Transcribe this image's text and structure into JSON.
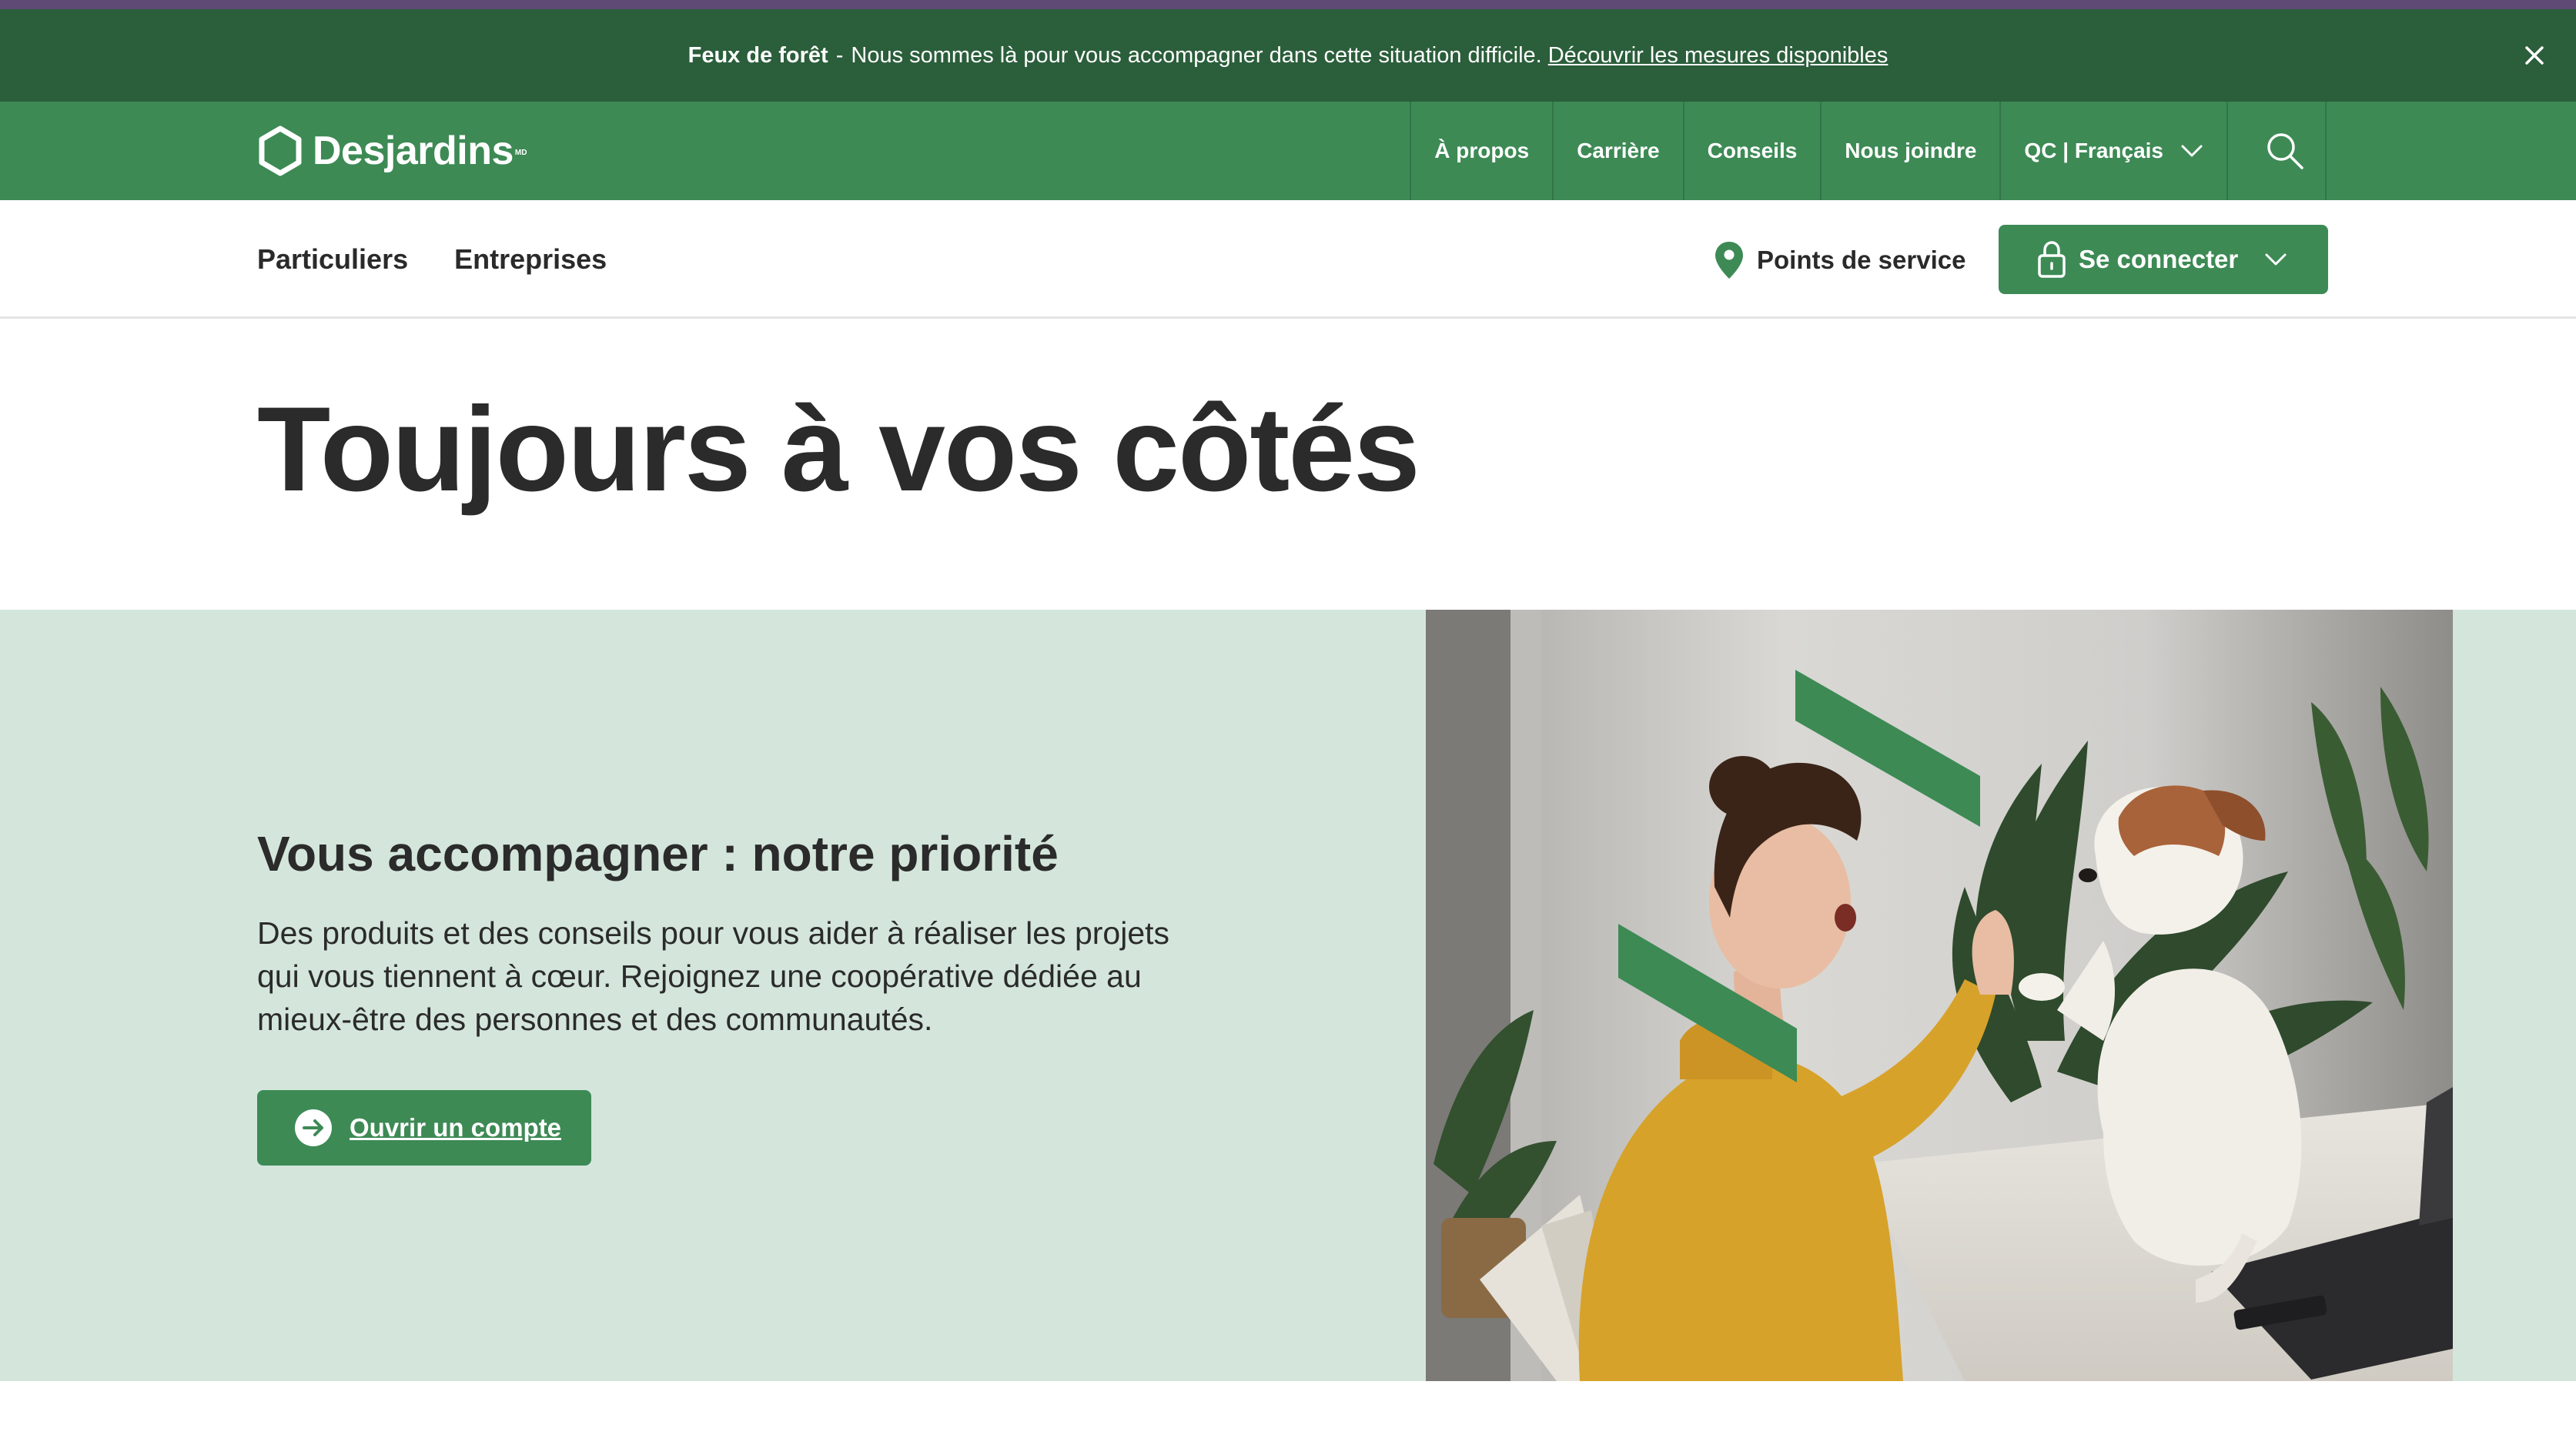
{
  "alert": {
    "title": "Feux de forêt",
    "separator": "-",
    "message": "Nous sommes là pour vous accompagner dans cette situation difficile.",
    "link": "Découvrir les mesures disponibles"
  },
  "brand": {
    "name": "Desjardins",
    "mark": "MD"
  },
  "top_nav": {
    "items": [
      "À propos",
      "Carrière",
      "Conseils",
      "Nous joindre"
    ],
    "language": "QC | Français"
  },
  "sub_nav": {
    "tabs": [
      "Particuliers",
      "Entreprises"
    ],
    "service_points": "Points de service",
    "connect": "Se connecter"
  },
  "hero": {
    "title": "Toujours à vos côtés"
  },
  "feature": {
    "title": "Vous accompagner : notre priorité",
    "text": "Des produits et des conseils pour vous aider à réaliser les projets qui vous tiennent à cœur. Rejoignez une coopérative dédiée au mieux-être des personnes et des communautés.",
    "button": "Ouvrir un compte"
  },
  "colors": {
    "brand_green": "#3d8a55",
    "alert_green": "#2b5e3b",
    "feature_bg": "#d4e6dc",
    "top_stripe": "#5e4a74"
  }
}
